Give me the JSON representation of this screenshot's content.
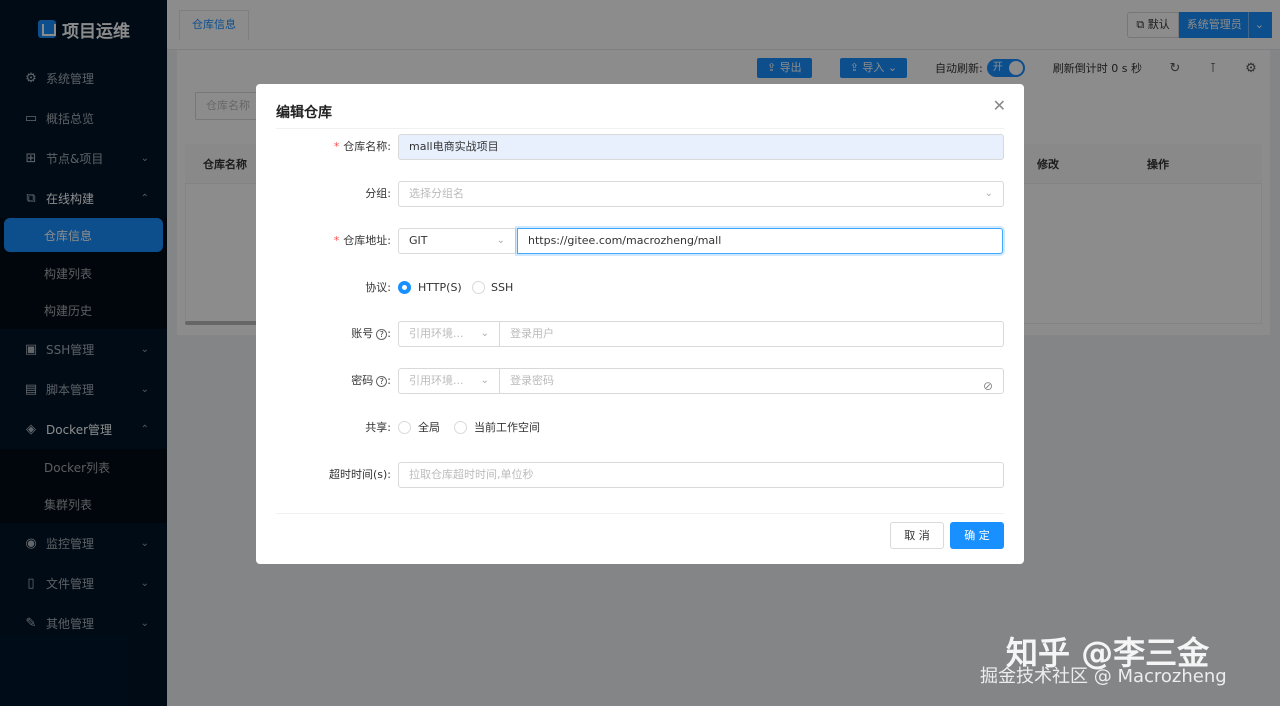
{
  "app": {
    "title": "项目运维"
  },
  "sidebar": {
    "items": [
      {
        "label": "系统管理",
        "icon": "gear-icon",
        "arrow": ""
      },
      {
        "label": "概括总览",
        "icon": "monitor-icon",
        "arrow": ""
      },
      {
        "label": "节点&项目",
        "icon": "nodes-icon",
        "arrow": "⌄"
      },
      {
        "label": "在线构建",
        "icon": "build-icon",
        "arrow": "⌃"
      }
    ],
    "build_sub": [
      "仓库信息",
      "构建列表",
      "构建历史"
    ],
    "items2": [
      {
        "label": "SSH管理",
        "icon": "terminal-icon",
        "arrow": "⌄"
      },
      {
        "label": "脚本管理",
        "icon": "script-icon",
        "arrow": "⌄"
      },
      {
        "label": "Docker管理",
        "icon": "docker-icon",
        "arrow": "⌃"
      }
    ],
    "docker_sub": [
      "Docker列表",
      "集群列表"
    ],
    "items3": [
      {
        "label": "监控管理",
        "icon": "monitor-alert-icon",
        "arrow": "⌄"
      },
      {
        "label": "文件管理",
        "icon": "file-icon",
        "arrow": "⌄"
      },
      {
        "label": "其他管理",
        "icon": "wrench-icon",
        "arrow": "⌄"
      }
    ]
  },
  "topbar": {
    "tab": "仓库信息",
    "workspace": "默认",
    "user": "系统管理员"
  },
  "toolbar": {
    "export": "导出",
    "import": "导入",
    "auto_refresh": "自动刷新:",
    "switch_on": "开",
    "countdown": "刷新倒计时 0 s 秒"
  },
  "list": {
    "search_placeholder": "仓库名称",
    "col_name": "仓库名称",
    "col_modify": "修改",
    "col_ops": "操作"
  },
  "modal": {
    "title": "编辑仓库",
    "name_label": "仓库名称:",
    "name_value": "mall电商实战项目",
    "group_label": "分组:",
    "group_placeholder": "选择分组名",
    "addr_label": "仓库地址:",
    "addr_type": "GIT",
    "addr_value": "https://gitee.com/macrozheng/mall",
    "protocol_label": "协议:",
    "protocol_http": "HTTP(S)",
    "protocol_ssh": "SSH",
    "account_label": "账号",
    "account_env_placeholder": "引用环境...",
    "account_placeholder": "登录用户",
    "password_label": "密码",
    "password_env_placeholder": "引用环境...",
    "password_placeholder": "登录密码",
    "share_label": "共享:",
    "share_global": "全局",
    "share_current": "当前工作空间",
    "timeout_label": "超时时间(s):",
    "timeout_placeholder": "拉取仓库超时时间,单位秒",
    "cancel": "取 消",
    "ok": "确 定"
  },
  "watermark": {
    "line1": "知乎 @李三金",
    "line2": "掘金技术社区 @ Macrozheng"
  }
}
